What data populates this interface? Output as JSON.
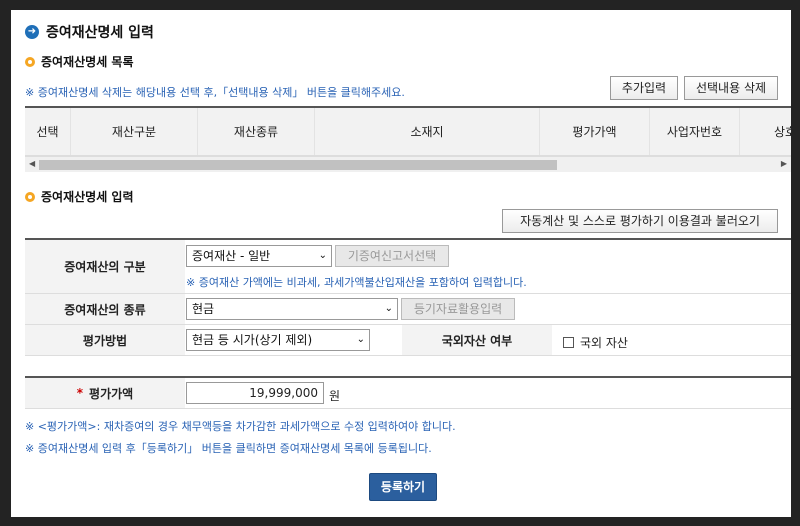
{
  "page_title": "증여재산명세 입력",
  "list_section": {
    "title": "증여재산명세 목록",
    "notice": "※ 증여재산명세 삭제는 해당내용 선택 후,「선택내용 삭제」 버튼을 클릭해주세요.",
    "add_button": "추가입력",
    "delete_button": "선택내용 삭제",
    "columns": [
      "선택",
      "재산구분",
      "재산종류",
      "소재지",
      "평가가액",
      "사업자번호",
      "상호"
    ]
  },
  "input_section": {
    "title": "증여재산명세 입력",
    "load_button": "자동계산 및 스스로 평가하기 이용결과 불러오기",
    "category_label": "증여재산의 구분",
    "category_value": "증여재산 - 일반",
    "prior_report_button": "기증여신고서선택",
    "category_note": "※ 증여재산 가액에는 비과세, 과세가액불산입재산을 포함하여 입력합니다.",
    "type_label": "증여재산의 종류",
    "type_value": "현금",
    "registry_button": "등기자료활용입력",
    "method_label": "평가방법",
    "method_value": "현금 등 시가(상기 제외)",
    "foreign_label": "국외자산 여부",
    "foreign_checkbox_label": "국외 자산",
    "value_label": "평가가액",
    "value_required_mark": "*",
    "value_amount": "19,999,000",
    "value_unit": "원",
    "note1": "※ <평가가액>: 재차증여의 경우 채무액등을 차가감한 과세가액으로 수정 입력하여야 합니다.",
    "note2": "※ 증여재산명세 입력 후「등록하기」 버튼을 클릭하면 증여재산명세 목록에 등록됩니다.",
    "register_button": "등록하기"
  }
}
